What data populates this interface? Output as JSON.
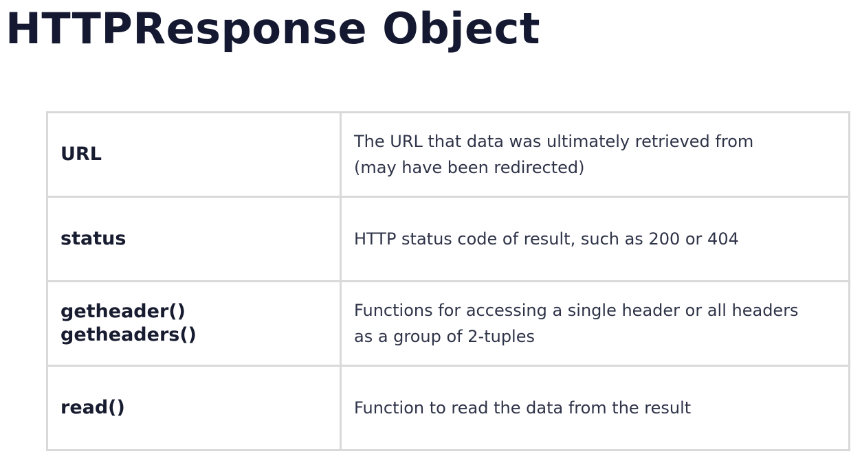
{
  "title": "HTTPResponse Object",
  "rows": [
    {
      "name": "URL",
      "description": "The URL that data was ultimately retrieved from\n(may have been redirected)"
    },
    {
      "name": "status",
      "description": "HTTP status code of result, such as 200 or 404"
    },
    {
      "name": "getheader()\ngetheaders()",
      "description": "Functions for accessing a single header or all headers\nas a group of 2-tuples"
    },
    {
      "name": "read()",
      "description": "Function to read the data from the result"
    }
  ]
}
